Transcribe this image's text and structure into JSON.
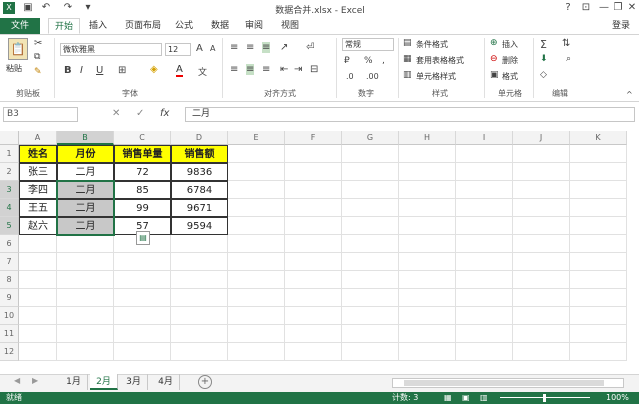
{
  "window": {
    "title": "数据合并.xlsx - Excel",
    "help": "?",
    "minimize": "—",
    "restore": "❐",
    "close": "✕"
  },
  "tabs": [
    "文件",
    "开始",
    "插入",
    "页面布局",
    "公式",
    "数据",
    "审阅",
    "视图"
  ],
  "account": "登录",
  "ribbon": {
    "clipboard": {
      "paste": "粘贴",
      "group": "剪贴板"
    },
    "font": {
      "name": "微软雅黑",
      "size": "12",
      "group": "字体",
      "bold": "B",
      "italic": "I",
      "underline": "U",
      "grow": "A",
      "shrink": "A",
      "color_letter": "A"
    },
    "alignment": {
      "group": "对齐方式"
    },
    "number": {
      "format": "常规",
      "group": "数字",
      "percent": "%",
      "comma": ","
    },
    "styles": {
      "cond": "条件格式",
      "table": "套用表格格式",
      "cell": "单元格样式",
      "group": "样式"
    },
    "cells": {
      "insert": "插入",
      "delete": "删除",
      "format": "格式",
      "group": "单元格"
    },
    "editing": {
      "sum": "Σ",
      "group": "编辑"
    }
  },
  "formula": {
    "namebox": "B3",
    "fx": "fx",
    "value": "二月",
    "cancel": "✕",
    "confirm": "✓"
  },
  "columns": [
    "A",
    "B",
    "C",
    "D",
    "E",
    "F",
    "G",
    "H",
    "I",
    "J",
    "K"
  ],
  "rows": [
    "1",
    "2",
    "3",
    "4",
    "5",
    "6",
    "7",
    "8",
    "9",
    "10",
    "11",
    "12"
  ],
  "table": {
    "headers": [
      "姓名",
      "月份",
      "销售单量",
      "销售额"
    ],
    "data": [
      [
        "张三",
        "二月",
        "72",
        "9836"
      ],
      [
        "李四",
        "二月",
        "85",
        "6784"
      ],
      [
        "王五",
        "二月",
        "99",
        "9671"
      ],
      [
        "赵六",
        "二月",
        "57",
        "9594"
      ]
    ]
  },
  "sheets": [
    "1月",
    "2月",
    "3月",
    "4月"
  ],
  "add_sheet": "+",
  "status": {
    "ready": "就绪",
    "count": "计数: 3",
    "zoom": "100%"
  },
  "colors": {
    "accent": "#217346",
    "header_fill": "#ffff00",
    "selected_fill": "#c8c8c8"
  }
}
